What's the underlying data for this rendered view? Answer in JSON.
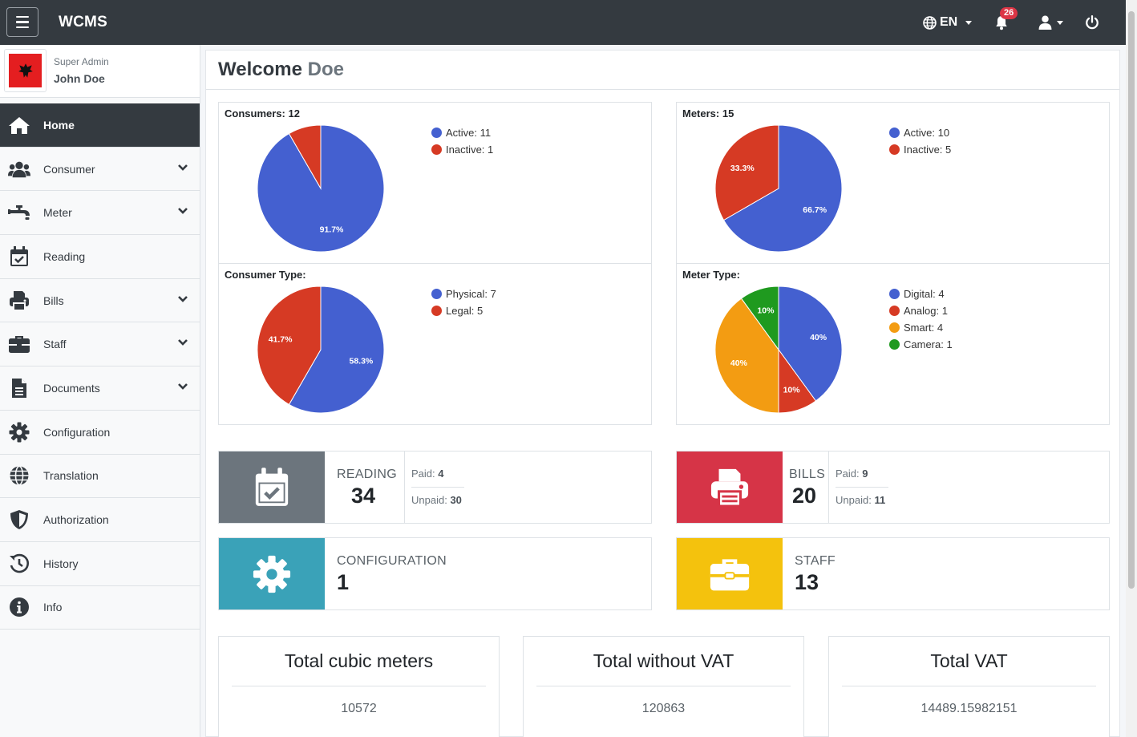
{
  "navbar": {
    "brand": "WCMS",
    "language": "EN",
    "notification_count": "26"
  },
  "user": {
    "role": "Super Admin",
    "name": "John Doe"
  },
  "sidebar": {
    "items": [
      {
        "label": "Home",
        "icon": "home-icon",
        "active": true,
        "has_submenu": false
      },
      {
        "label": "Consumer",
        "icon": "users-icon",
        "active": false,
        "has_submenu": true
      },
      {
        "label": "Meter",
        "icon": "faucet-icon",
        "active": false,
        "has_submenu": true
      },
      {
        "label": "Reading",
        "icon": "calendar-check-icon",
        "active": false,
        "has_submenu": false
      },
      {
        "label": "Bills",
        "icon": "printer-icon",
        "active": false,
        "has_submenu": true
      },
      {
        "label": "Staff",
        "icon": "briefcase-icon",
        "active": false,
        "has_submenu": true
      },
      {
        "label": "Documents",
        "icon": "file-icon",
        "active": false,
        "has_submenu": true
      },
      {
        "label": "Configuration",
        "icon": "gear-icon",
        "active": false,
        "has_submenu": false
      },
      {
        "label": "Translation",
        "icon": "globe-icon",
        "active": false,
        "has_submenu": false
      },
      {
        "label": "Authorization",
        "icon": "shield-icon",
        "active": false,
        "has_submenu": false
      },
      {
        "label": "History",
        "icon": "history-icon",
        "active": false,
        "has_submenu": false
      },
      {
        "label": "Info",
        "icon": "info-icon",
        "active": false,
        "has_submenu": false
      }
    ]
  },
  "main": {
    "welcome_prefix": "Welcome",
    "welcome_name": "Doe"
  },
  "colors": {
    "blue": "#4460d0",
    "red": "#d63a24",
    "orange": "#f39c12",
    "green": "#1f9a1f",
    "reading": "#6c757d",
    "bills": "#d63447",
    "configuration": "#3aa2b8",
    "staff": "#f4c20d"
  },
  "chart_data": [
    {
      "type": "pie",
      "title": "Consumers: 12",
      "categories": [
        "Active: 11",
        "Inactive: 1"
      ],
      "values": [
        11,
        1
      ],
      "slice_labels": [
        "91.7%",
        ""
      ],
      "colors": [
        "#4460d0",
        "#d63a24"
      ],
      "legend": "top-right"
    },
    {
      "type": "pie",
      "title": "Meters: 15",
      "categories": [
        "Active: 10",
        "Inactive: 5"
      ],
      "values": [
        10,
        5
      ],
      "slice_labels": [
        "66.7%",
        "33.3%"
      ],
      "colors": [
        "#4460d0",
        "#d63a24"
      ],
      "legend": "top-right"
    },
    {
      "type": "pie",
      "title": "Consumer Type:",
      "categories": [
        "Physical: 7",
        "Legal: 5"
      ],
      "values": [
        7,
        5
      ],
      "slice_labels": [
        "58.3%",
        "41.7%"
      ],
      "colors": [
        "#4460d0",
        "#d63a24"
      ],
      "legend": "top-right"
    },
    {
      "type": "pie",
      "title": "Meter Type:",
      "categories": [
        "Digital: 4",
        "Analog: 1",
        "Smart: 4",
        "Camera: 1"
      ],
      "values": [
        4,
        1,
        4,
        1
      ],
      "slice_labels": [
        "40%",
        "10%",
        "40%",
        "10%"
      ],
      "colors": [
        "#4460d0",
        "#d63a24",
        "#f39c12",
        "#1f9a1f"
      ],
      "legend": "top-right"
    }
  ],
  "info_boxes": {
    "reading": {
      "label": "READING",
      "value": "34",
      "paid_label": "Paid:",
      "paid": "4",
      "unpaid_label": "Unpaid:",
      "unpaid": "30"
    },
    "bills": {
      "label": "BILLS",
      "value": "20",
      "paid_label": "Paid:",
      "paid": "9",
      "unpaid_label": "Unpaid:",
      "unpaid": "11"
    },
    "configuration": {
      "label": "CONFIGURATION",
      "value": "1"
    },
    "staff": {
      "label": "STAFF",
      "value": "13"
    }
  },
  "totals": [
    {
      "title": "Total cubic meters",
      "value": "10572"
    },
    {
      "title": "Total without VAT",
      "value": "120863"
    },
    {
      "title": "Total VAT",
      "value": "14489.15982151"
    }
  ]
}
